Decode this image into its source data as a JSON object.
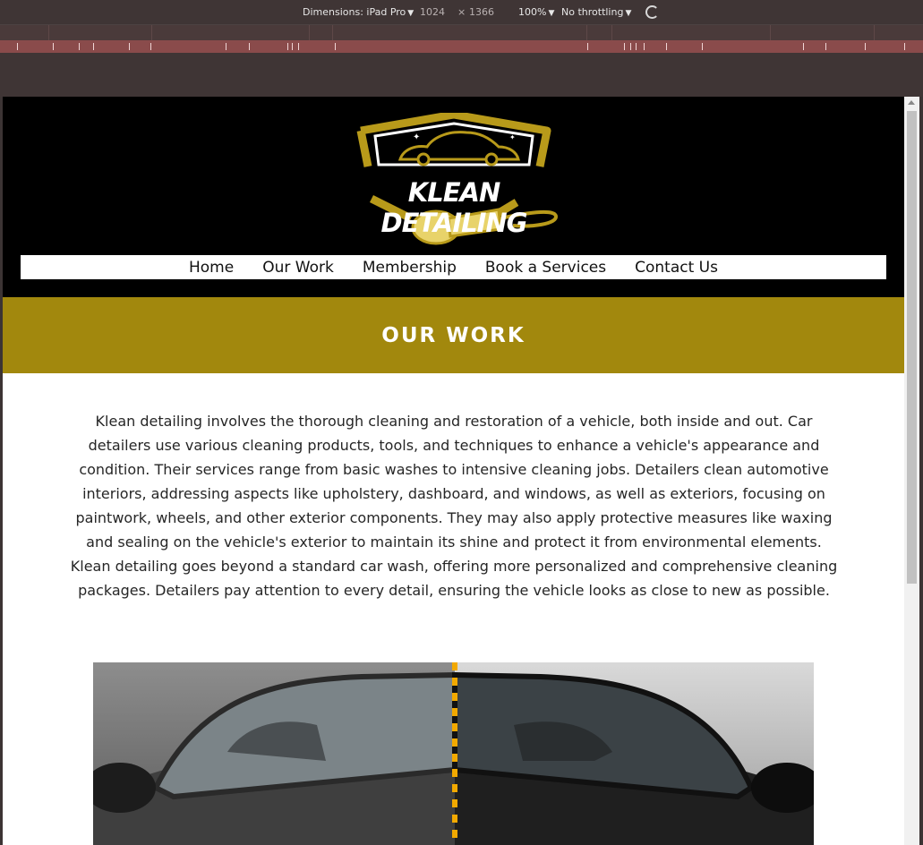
{
  "devtools": {
    "device_label": "Dimensions: iPad Pro",
    "width": "1024",
    "times": "×",
    "height": "1366",
    "zoom": "100%",
    "throttle": "No throttling"
  },
  "site": {
    "brand": "KLEAN DETAILING",
    "nav": [
      "Home",
      "Our Work",
      "Membership",
      "Book a Services",
      "Contact Us"
    ],
    "banner_title": "OUR WORK",
    "intro": "Klean detailing involves the thorough cleaning and restoration of a vehicle, both inside and out. Car detailers use various cleaning products, tools, and techniques to enhance a vehicle's appearance and condition. Their services range from basic washes to intensive cleaning jobs. Detailers clean automotive interiors, addressing aspects like upholstery, dashboard, and windows, as well as exteriors, focusing on paintwork, wheels, and other exterior components. They may also apply protective measures like waxing and sealing on the vehicle's exterior to maintain its shine and protect it from environmental elements. Klean detailing goes beyond a standard car wash, offering more personalized and comprehensive cleaning packages. Detailers pay attention to every detail, ensuring the vehicle looks as close to new as possible."
  },
  "colors": {
    "header_bg": "#000000",
    "banner_gold": "#a2880d",
    "logo_gold": "#b89a1a",
    "devtools_bg": "#3f3535",
    "mq_bar": "#8a4b4b"
  },
  "icons": [
    "caret-down-icon",
    "rotate-icon",
    "car-logo-icon",
    "polisher-icon"
  ]
}
